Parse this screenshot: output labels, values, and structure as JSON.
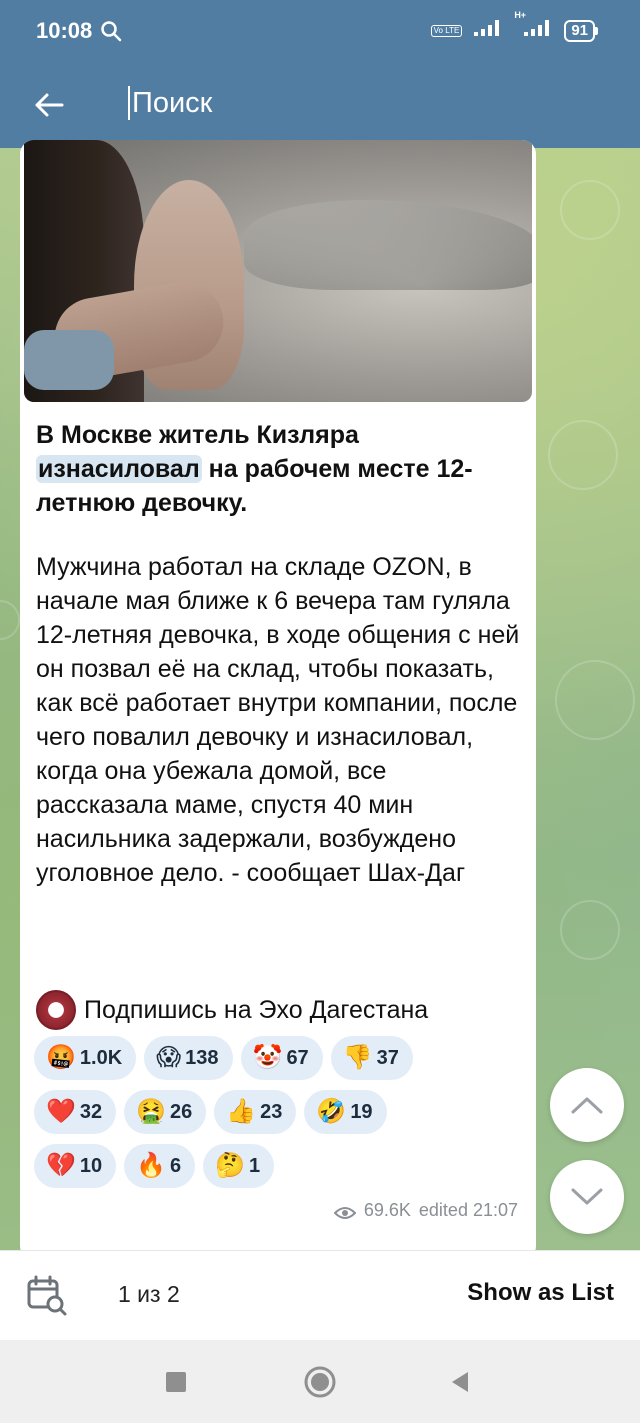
{
  "status_bar": {
    "time": "10:08",
    "network_label": "Vo LTE",
    "hplus_label": "H+",
    "battery": "91"
  },
  "header": {
    "search_placeholder": "Поиск"
  },
  "message": {
    "title_before": "В Москве житель Кизляра ",
    "title_highlight": "изнасиловал",
    "title_after": " на рабочем месте 12-летнюю девочку.",
    "body": "Мужчина работал на складе OZON, в начале мая ближе к 6 вечера там гуляла 12-летняя девочка, в ходе общения с ней он позвал её на склад, чтобы показать, как всё работает внутри компании, после чего повалил девочку и изнасиловал, когда она убежала домой, все рассказала маме, спустя 40 мин насильника задержали, возбуждено уголовное дело. - сообщает Шах-Даг",
    "subscribe_text": "Подпишись на Эхо Дагестана",
    "reactions": [
      {
        "emoji": "🤬",
        "count": "1.0K"
      },
      {
        "emoji": "😱",
        "count": "138"
      },
      {
        "emoji": "🤡",
        "count": "67"
      },
      {
        "emoji": "👎",
        "count": "37"
      },
      {
        "emoji": "❤️",
        "count": "32"
      },
      {
        "emoji": "🤮",
        "count": "26"
      },
      {
        "emoji": "👍",
        "count": "23"
      },
      {
        "emoji": "🤣",
        "count": "19"
      },
      {
        "emoji": "💔",
        "count": "10"
      },
      {
        "emoji": "🔥",
        "count": "6"
      },
      {
        "emoji": "🤔",
        "count": "1"
      }
    ],
    "views": "69.6K",
    "edited": "edited 21:07"
  },
  "bottom_bar": {
    "counter": "1 из 2",
    "show_as_list": "Show as List"
  },
  "icons": {
    "back": "arrow-left-icon",
    "calendar": "calendar-search-icon",
    "scroll_up": "chevron-up-icon",
    "scroll_down": "chevron-down-icon"
  },
  "colors": {
    "header": "#527da3",
    "reaction_bg": "#e2edf7",
    "highlight": "#d8e6f2"
  }
}
